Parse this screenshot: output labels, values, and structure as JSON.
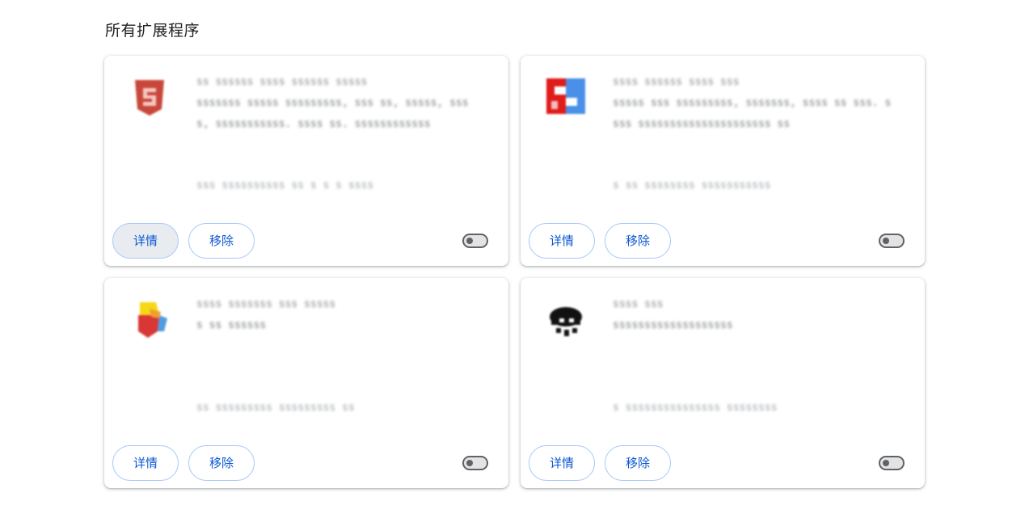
{
  "section_title": "所有扩展程序",
  "extensions": [
    {
      "icon": "red-s-shield-icon",
      "name": "ss ssssss ssss ssssss sssss",
      "description": "sssssss sssss sssssssss, sss ss, sssss, sss s, sssssssssss. ssss ss. ssssssssssss",
      "id": "sss ssssssssss ss s s s ssss",
      "details_label": "详情",
      "remove_label": "移除",
      "enabled": false
    },
    {
      "icon": "red-blue-puzzle-icon",
      "name": "ssss ssssss ssss sss",
      "description": "sssss sss sssssssss, sssssss, ssss ss sss. ssss sssssssssssssssssssss ss",
      "id": "s ss ssssssss sssssssssss",
      "details_label": "详情",
      "remove_label": "移除",
      "enabled": false
    },
    {
      "icon": "colorful-hexagon-icon",
      "name": "ssss sssssss sss sssss",
      "description": "s ss ssssss",
      "id": "ss sssssssss sssssssss ss",
      "details_label": "详情",
      "remove_label": "移除",
      "enabled": false
    },
    {
      "icon": "black-cloud-icon",
      "name": "ssss sss",
      "description": "sssssssssssssssssss",
      "id": "s sssssssssssssss ssssssss",
      "details_label": "详情",
      "remove_label": "移除",
      "enabled": false
    }
  ]
}
